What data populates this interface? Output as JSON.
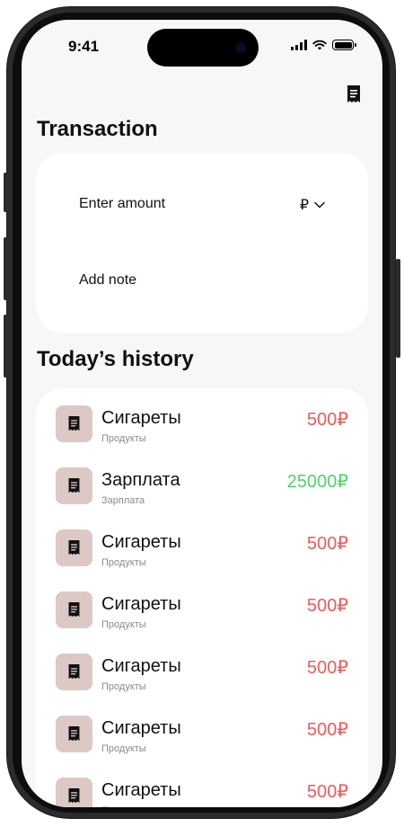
{
  "status": {
    "time": "9:41"
  },
  "transaction": {
    "title": "Transaction",
    "amount_placeholder": "Enter amount",
    "currency": "₽",
    "note_placeholder": "Add note"
  },
  "history": {
    "title": "Today’s history",
    "items": [
      {
        "title": "Сигареты",
        "category": "Продукты",
        "amount": "500₽",
        "type": "expense"
      },
      {
        "title": "Зарплата",
        "category": "Зарплата",
        "amount": "25000₽",
        "type": "income"
      },
      {
        "title": "Сигареты",
        "category": "Продукты",
        "amount": "500₽",
        "type": "expense"
      },
      {
        "title": "Сигареты",
        "category": "Продукты",
        "amount": "500₽",
        "type": "expense"
      },
      {
        "title": "Сигареты",
        "category": "Продукты",
        "amount": "500₽",
        "type": "expense"
      },
      {
        "title": "Сигареты",
        "category": "Продукты",
        "amount": "500₽",
        "type": "expense"
      },
      {
        "title": "Сигареты",
        "category": "Продукты",
        "amount": "500₽",
        "type": "expense"
      }
    ]
  },
  "colors": {
    "expense": "#f05a5a",
    "income": "#4fd36b",
    "icon_bg": "#dcc9c6",
    "background": "#f6f7f9"
  },
  "icons": {
    "header": "receipt-icon",
    "item": "receipt-icon"
  }
}
